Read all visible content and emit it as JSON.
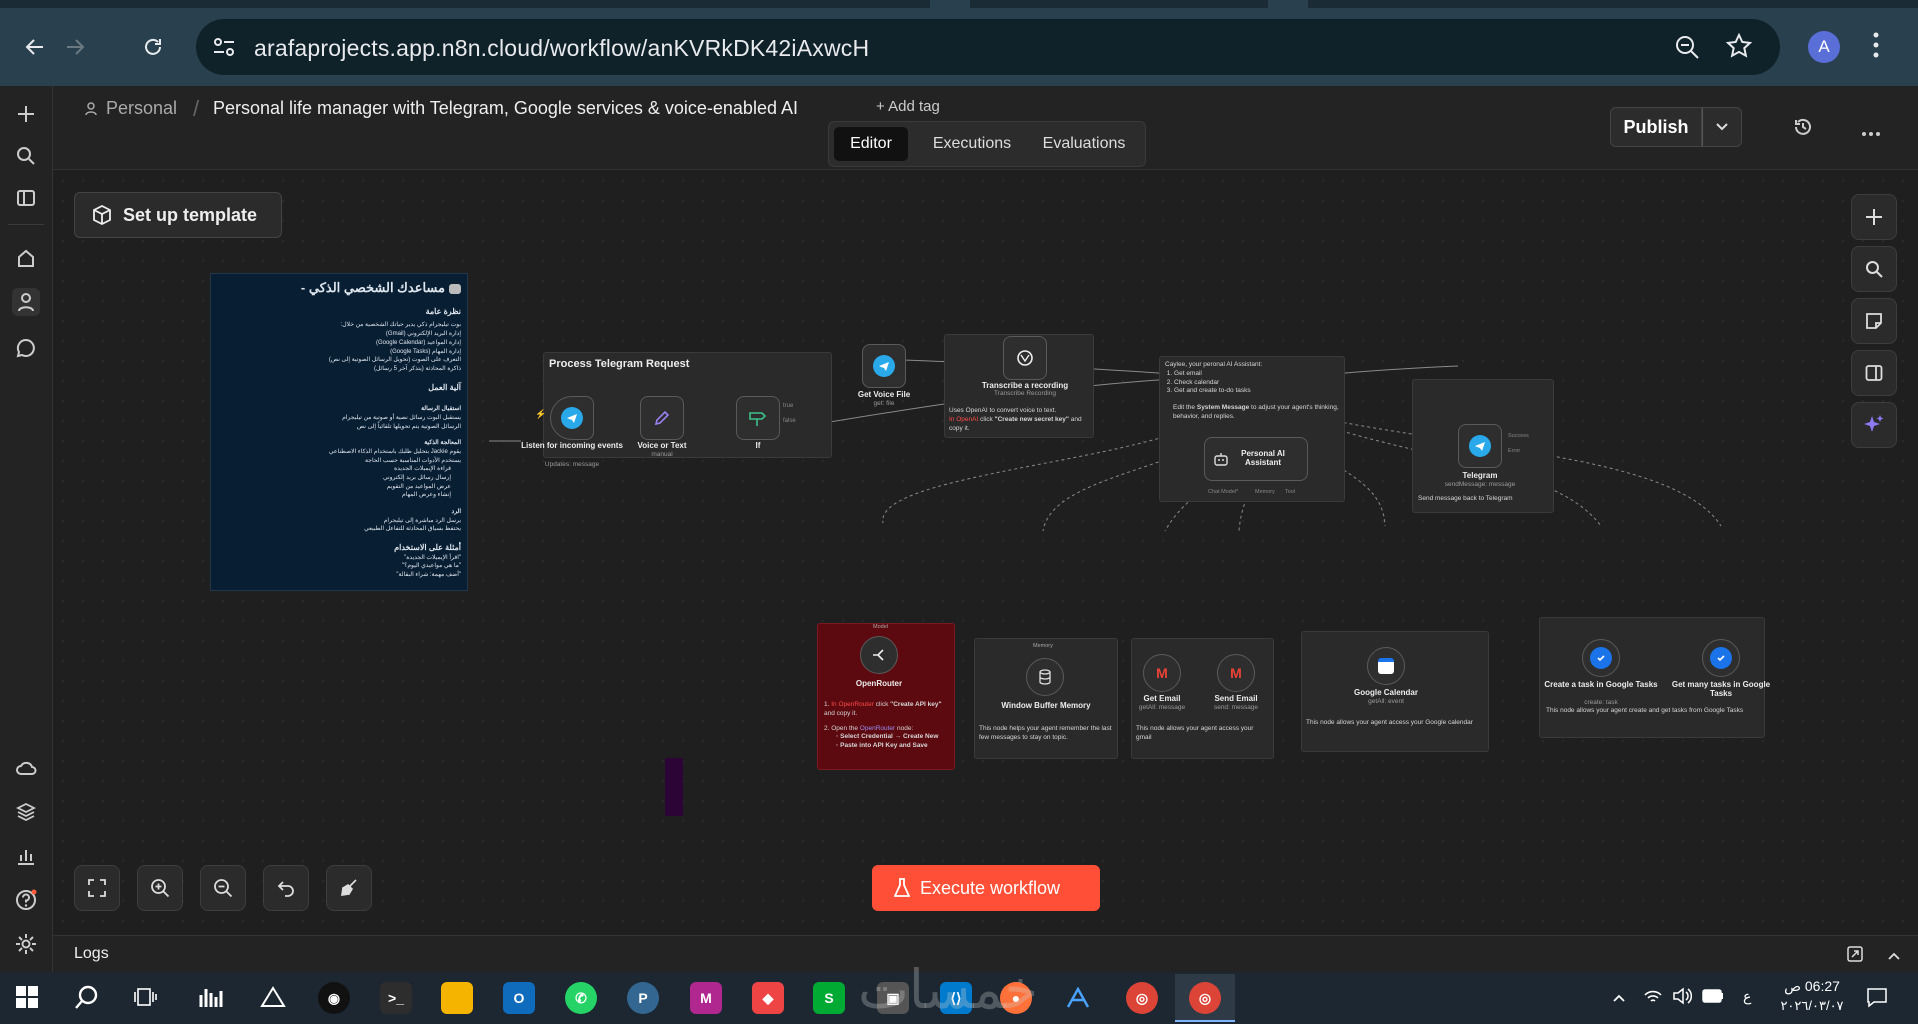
{
  "browser": {
    "url": "arafaprojects.app.n8n.cloud/workflow/anKVRkDK42iAxwcH",
    "profile_initial": "A"
  },
  "header": {
    "breadcrumb_project": "Personal",
    "workflow_title": "Personal life manager with Telegram, Google services & voice-enabled AI",
    "add_tag": "+ Add tag",
    "publish_label": "Publish",
    "tabs": [
      {
        "label": "Editor",
        "active": true
      },
      {
        "label": "Executions",
        "active": false
      },
      {
        "label": "Evaluations",
        "active": false
      }
    ]
  },
  "canvas": {
    "setup_template": "Set up template",
    "execute_label": "Execute workflow",
    "logs_label": "Logs"
  },
  "arabic_note": {
    "title": "مساعدك الشخصي الذكي -",
    "overview_head": "نظرة عامة",
    "overview_intro": "بوت تيليجرام ذكي يدير حياتك الشخصية من خلال:",
    "overview_items": [
      "إدارة البريد الإلكتروني (Gmail)",
      "إدارة المواعيد (Google Calendar)",
      "إدارة المهام (Google Tasks)",
      "التعرف على الصوت (تحويل الرسائل الصوتية إلى نص)",
      "ذاكرة المحادثة (يتذكر آخر 5 رسائل)"
    ],
    "mech_head": "آلية العمل",
    "step1_head": "استقبال الرسالة",
    "step1_items": [
      "يستقبل البوت رسائل نصية أو صوتية من تيليجرام",
      "الرسائل الصوتية يتم تحويلها تلقائياً إلى نص"
    ],
    "step2_head": "المعالجة الذكية",
    "step2_items": [
      "يقوم Jackie بتحليل طلبك باستخدام الذكاء الاصطناعي",
      "يستخدم الأدوات المناسبة حسب الحاجة"
    ],
    "step2_sub": [
      "قراءة الإيميلات الجديدة",
      "إرسال رسائل بريد إلكتروني",
      "عرض المواعيد من التقويم",
      "إنشاء وعرض المهام"
    ],
    "step3_head": "الرد",
    "step3_items": [
      "يرسل الرد مباشرة إلى تيليجرام",
      "يحتفظ بسياق المحادثة للتفاعل الطبيعي"
    ],
    "examples_head": "أمثلة على الاستخدام",
    "examples": [
      "\"اقرأ الإيميلات الجديدة\"",
      "\"ما هي مواعيدي اليوم؟\"",
      "\"أضف مهمة: شراء البقالة\""
    ]
  },
  "groups": {
    "process_title": "Process Telegram Request",
    "openai_note_1": "Uses OpenAI to convert voice to text.",
    "openai_note_2a": "In OpenAI",
    "openai_note_2b": " click ",
    "openai_note_2c": "\"Create new secret key\"",
    "openai_note_2d": " and copy it.",
    "agent_note_title": "Caylee, your peronal AI Assistant:",
    "agent_note_items": [
      "Get email",
      "Check calendar",
      "Get and create to-do tasks"
    ],
    "agent_note_edit_a": "Edit the ",
    "agent_note_edit_b": "System Message",
    "agent_note_edit_c": " to adjust your agent's thinking, behavior, and replies.",
    "telegram_send_note": "Send message back to Telegram",
    "openrouter_note_1a": "In ",
    "openrouter_note_1b": "OpenRouter",
    "openrouter_note_1c": " click ",
    "openrouter_note_1d": "\"Create API key\"",
    "openrouter_note_1e": " and copy it.",
    "openrouter_note_2a": "Open the ",
    "openrouter_note_2b": "OpenRouter",
    "openrouter_note_2c": " node:",
    "openrouter_note_2d": "Select Credential → Create New",
    "openrouter_note_2e": "Paste into API Key and Save",
    "memory_note": "This node helps your agent remember the last few messages to stay on topic.",
    "gmail_note": "This node allows your agent access your gmail",
    "calendar_note": "This node allows your agent access your Google calendar",
    "tasks_note": "This node allows your agent create and get tasks from Google Tasks"
  },
  "nodes": [
    {
      "id": "listen",
      "label": "Listen for incoming events",
      "sub": "Updates: message"
    },
    {
      "id": "voice",
      "label": "Voice or Text",
      "sub": "manual"
    },
    {
      "id": "if",
      "label": "If",
      "sub": "",
      "out_true": "true",
      "out_false": "false"
    },
    {
      "id": "getvoice",
      "label": "Get Voice File",
      "sub": "get: file"
    },
    {
      "id": "transcribe",
      "label": "Transcribe a recording",
      "sub": "Transcribe Recording"
    },
    {
      "id": "agent",
      "label": "Personal AI Assistant",
      "ports": [
        "Chat Model*",
        "Memory",
        "Tool"
      ]
    },
    {
      "id": "telegram",
      "label": "Telegram",
      "sub": "sendMessage: message",
      "out_success": "Success",
      "out_error": "Error"
    },
    {
      "id": "openrouter",
      "label": "OpenRouter",
      "top": "Model"
    },
    {
      "id": "memory",
      "label": "Window Buffer Memory",
      "top": "Memory"
    },
    {
      "id": "getemail",
      "label": "Get Email",
      "sub": "getAll: message"
    },
    {
      "id": "sendemail",
      "label": "Send Email",
      "sub": "send: message"
    },
    {
      "id": "calendar",
      "label": "Google Calendar",
      "sub": "getAll: event"
    },
    {
      "id": "createtask",
      "label": "Create a task in Google Tasks",
      "sub": "create: task"
    },
    {
      "id": "gettasks",
      "label": "Get many tasks in Google Tasks",
      "sub": "getAll: task"
    }
  ],
  "taskbar": {
    "time": "06:27 ص",
    "date": "٢٠٢٦/٠٣/٠٧",
    "lang": "ع",
    "watermark": "خمسات"
  },
  "colors": {
    "accent": "#ff5c3f",
    "openrouter_bg": "#5c0a0f",
    "canvas": "#1f1f1f"
  }
}
